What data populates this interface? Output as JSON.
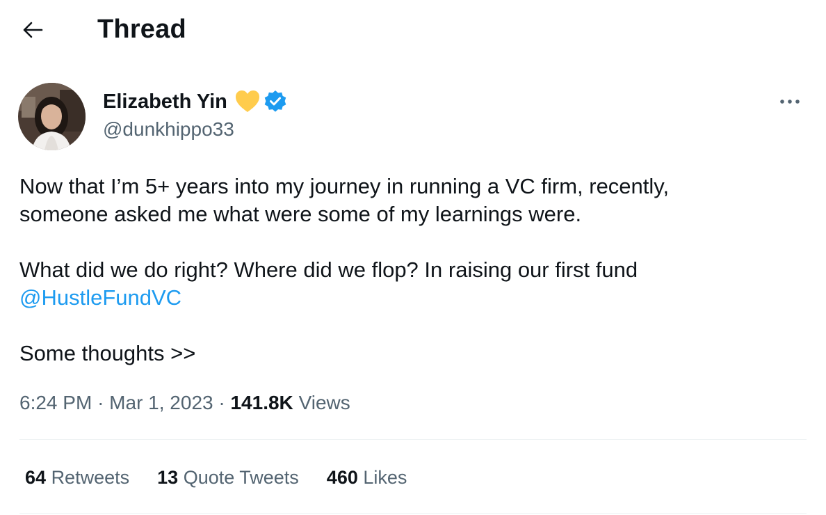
{
  "header": {
    "title": "Thread"
  },
  "author": {
    "name": "Elizabeth Yin",
    "handle": "@dunkhippo33"
  },
  "tweet": {
    "line1": "Now that I’m 5+ years into my journey in running a VC firm, recently,",
    "line2": "someone asked me what were some of my learnings were.",
    "line3": "What did we do right? Where did we flop? In raising our first fund",
    "mention": "@HustleFundVC",
    "line4": "Some thoughts >>"
  },
  "meta": {
    "time": "6:24 PM",
    "date": "Mar 1, 2023",
    "views_count": "141.8K",
    "views_label": "Views",
    "separator": "·"
  },
  "stats": [
    {
      "count": "64",
      "label": "Retweets"
    },
    {
      "count": "13",
      "label": "Quote Tweets"
    },
    {
      "count": "460",
      "label": "Likes"
    }
  ],
  "icons": {
    "back": "arrow-left-icon",
    "heart": "yellow-heart-icon",
    "verified": "verified-badge-icon",
    "more": "more-dots-icon"
  },
  "colors": {
    "text": "#0f1419",
    "secondary": "#536471",
    "accent": "#1d9bf0",
    "heart": "#ffcc4d",
    "divider": "#eff3f4"
  }
}
